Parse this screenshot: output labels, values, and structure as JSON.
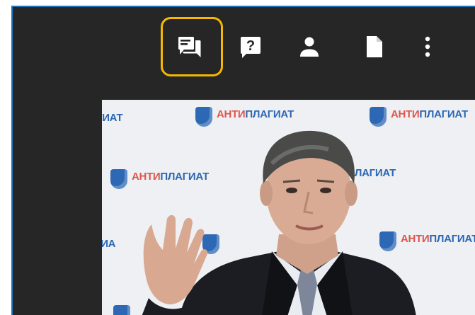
{
  "toolbar": {
    "buttons": [
      {
        "name": "chat",
        "icon": "chat-icon",
        "highlighted": true
      },
      {
        "name": "help",
        "icon": "question-icon",
        "label": "?"
      },
      {
        "name": "people",
        "icon": "person-icon"
      },
      {
        "name": "document",
        "icon": "document-icon"
      },
      {
        "name": "more",
        "icon": "more-vertical-icon"
      }
    ]
  },
  "colors": {
    "panel": "#262626",
    "highlight": "#f5b800",
    "border": "#1e73b8",
    "brand_red": "#e0554c",
    "brand_blue": "#2c68b4"
  },
  "video": {
    "logos": [
      {
        "red": "",
        "blue": "ГИАТ"
      },
      {
        "red": "АНТИ",
        "blue": "ПЛАГИАТ"
      },
      {
        "red": "АНТИ",
        "blue": "ПЛАГИАТ"
      },
      {
        "red": "АНТИ",
        "blue": "ПЛАГИАТ"
      },
      {
        "red": "АН",
        "blue": "ТИПЛАГИАТ"
      },
      {
        "red": "",
        "blue": "ГИА"
      },
      {
        "red": "АНТИ",
        "blue": "ПЛАГИАТ"
      }
    ]
  }
}
